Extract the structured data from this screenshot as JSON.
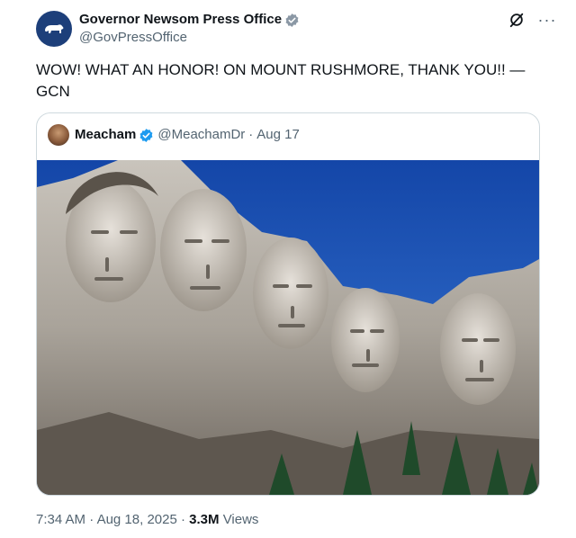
{
  "author": {
    "name": "Governor Newsom Press Office",
    "handle": "@GovPressOffice",
    "verified": true
  },
  "tweet": {
    "text": "WOW! WHAT AN HONOR! ON MOUNT RUSHMORE, THANK YOU!! — GCN"
  },
  "quoted_tweet": {
    "name": "Meacham",
    "handle": "@MeachamDr",
    "separator": "·",
    "date": "Aug 17",
    "verified": true,
    "image_description_icon": "mount-rushmore-photo"
  },
  "footer": {
    "time": "7:34 AM",
    "separator1": "·",
    "date": "Aug 18, 2025",
    "separator2": "·",
    "views_count": "3.3M",
    "views_label": "Views"
  },
  "colors": {
    "verified_blue": "#1d9bf0",
    "avatar_bg": "#1d3f7a",
    "sky": "#1b55b8",
    "secondary_text": "#536471"
  },
  "icons": {
    "grok": "grok-icon",
    "more": "more-icon"
  }
}
